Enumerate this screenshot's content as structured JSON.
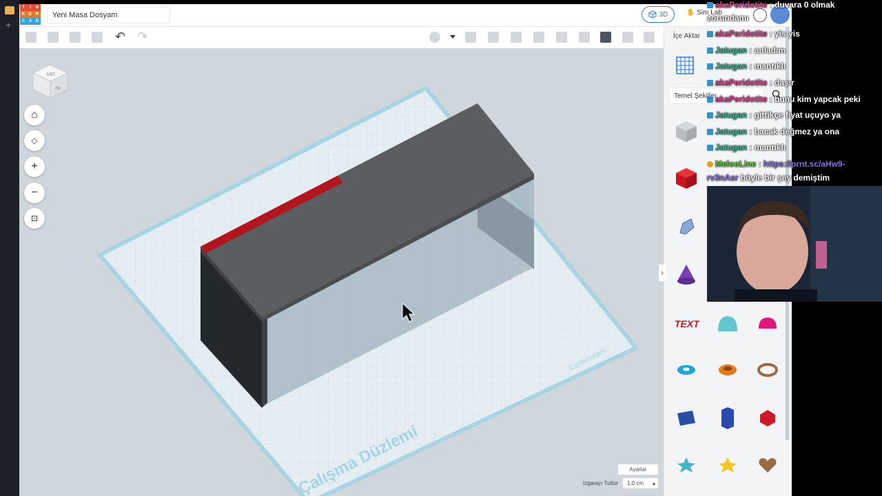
{
  "app": {
    "title": "Yeni Masa Dosyam",
    "logo_letters": [
      "T",
      "I",
      "N",
      "K",
      "E",
      "R",
      "C",
      "A",
      "D"
    ],
    "mode_3d": "3D",
    "simlab": "Sim Lab"
  },
  "panel": {
    "import": "İçe Aktar",
    "shape_category": "Temel Şekiller",
    "shapes": [
      "box-hole",
      "box",
      "scribble",
      "cylinder-hole",
      "roof",
      "text",
      "paraboloid",
      "sphere-red",
      "torus",
      "tube",
      "ring",
      "cube-blue",
      "hexagon",
      "icosahedron",
      "star-teal",
      "star-yellow",
      "heart"
    ]
  },
  "canvas": {
    "workplane_label": "Çalışma Düzlemi",
    "units": "Centimeters",
    "cube_top": "ÜST",
    "cube_front": "ÖN",
    "settings": "Ayarlar",
    "snap_label": "Izgarayı Tuttur",
    "snap_value": "1,0 cm"
  },
  "chat": [
    {
      "user": "akaPeridotite",
      "msg": "duvara 0 olmak",
      "msg2": "zorundamı",
      "color": "#d9448c"
    },
    {
      "user": "akaPeridotite",
      "msg": "yis yis",
      "color": "#d9448c"
    },
    {
      "user": "Jatugan",
      "msg": "anladım",
      "color": "#38b596"
    },
    {
      "user": "Jatugan",
      "msg": "mantıklı",
      "color": "#38b596"
    },
    {
      "user": "akaPeridotite",
      "msg": "daşır",
      "color": "#d9448c"
    },
    {
      "user": "akaPeridotite",
      "msg": "bunu kim yapcak peki",
      "color": "#d9448c"
    },
    {
      "user": "Jatugan",
      "msg": "gittikçe fiyat uçuyo ya",
      "color": "#38b596"
    },
    {
      "user": "Jatugan",
      "msg": "bacak değmez ya ona",
      "color": "#38b596"
    },
    {
      "user": "Jatugan",
      "msg": "mantıklı",
      "color": "#38b596"
    },
    {
      "user": "MelooLine",
      "msg": "https://prnt.sc/aHw9-",
      "msg2": "rv3nAsr",
      "msg3": "böyle bir şey demiştim",
      "color": "#5ecb3a",
      "link_color": "#8b6fe0"
    }
  ],
  "colors": {
    "accent": "#2b7bd9",
    "table_top": "#5a5e60",
    "table_legs": "#23282c",
    "red_strip": "#b3151f",
    "grid_plane": "#e4edf1"
  }
}
